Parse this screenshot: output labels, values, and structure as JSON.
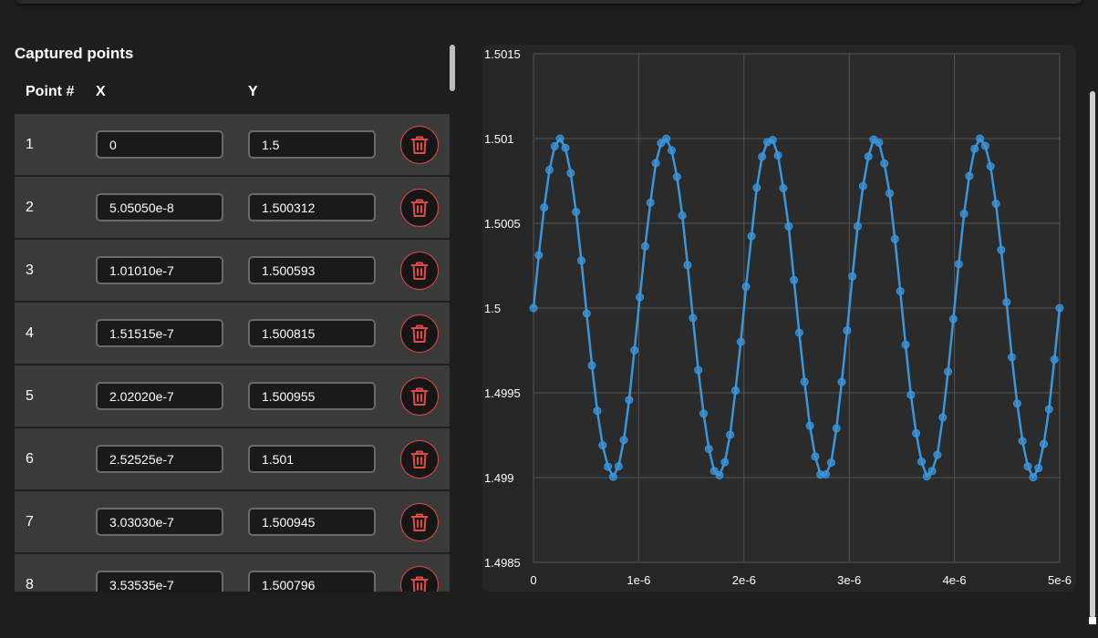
{
  "panel": {
    "title": "Captured points",
    "columns": {
      "point": "Point #",
      "x": "X",
      "y": "Y"
    }
  },
  "icons": {
    "delete": "trash-icon"
  },
  "colors": {
    "accent": "#3a96dd",
    "delete": "#e24a4a",
    "row_background": "#3a3a3a",
    "background": "#1e1e1e"
  },
  "points": [
    {
      "num": "1",
      "x": "0",
      "y": "1.5"
    },
    {
      "num": "2",
      "x": "5.05050e-8",
      "y": "1.500312"
    },
    {
      "num": "3",
      "x": "1.01010e-7",
      "y": "1.500593"
    },
    {
      "num": "4",
      "x": "1.51515e-7",
      "y": "1.500815"
    },
    {
      "num": "5",
      "x": "2.02020e-7",
      "y": "1.500955"
    },
    {
      "num": "6",
      "x": "2.52525e-7",
      "y": "1.501"
    },
    {
      "num": "7",
      "x": "3.03030e-7",
      "y": "1.500945"
    },
    {
      "num": "8",
      "x": "3.53535e-7",
      "y": "1.500796"
    }
  ],
  "chart_data": {
    "type": "line",
    "title": "",
    "xlabel": "",
    "ylabel": "",
    "xlim": [
      0,
      5e-06
    ],
    "ylim": [
      1.4985,
      1.5015
    ],
    "grid": true,
    "markers": true,
    "x_ticks": [
      0,
      1e-06,
      2e-06,
      3e-06,
      4e-06,
      5e-06
    ],
    "x_tick_labels": [
      "0",
      "1e-6",
      "2e-6",
      "3e-6",
      "4e-6",
      "5e-6"
    ],
    "y_ticks": [
      1.4985,
      1.499,
      1.4995,
      1.5,
      1.5005,
      1.501,
      1.5015
    ],
    "y_tick_labels": [
      "1.4985",
      "1.499",
      "1.4995",
      "1.5",
      "1.5005",
      "1.501",
      "1.5015"
    ],
    "series": [
      {
        "color": "#3a96dd",
        "x": [
          0,
          5.0505e-08,
          1.0101e-07,
          1.51515e-07,
          2.0202e-07,
          2.52525e-07,
          3.0303e-07,
          3.53535e-07,
          4.0404e-07,
          4.54545e-07,
          5.05051e-07,
          5.55556e-07,
          6.06061e-07,
          6.56566e-07,
          7.07071e-07,
          7.57576e-07,
          8.08081e-07,
          8.58586e-07,
          9.09091e-07,
          9.59596e-07,
          1.0101e-06,
          1.06061e-06,
          1.11111e-06,
          1.16162e-06,
          1.21212e-06,
          1.26263e-06,
          1.31313e-06,
          1.36364e-06,
          1.41414e-06,
          1.46465e-06,
          1.51515e-06,
          1.56566e-06,
          1.61616e-06,
          1.66667e-06,
          1.71717e-06,
          1.76768e-06,
          1.81818e-06,
          1.86869e-06,
          1.91919e-06,
          1.9697e-06,
          2.0202e-06,
          2.07071e-06,
          2.12121e-06,
          2.17172e-06,
          2.22222e-06,
          2.27273e-06,
          2.32323e-06,
          2.37374e-06,
          2.42424e-06,
          2.47475e-06,
          2.52525e-06,
          2.57576e-06,
          2.62626e-06,
          2.67677e-06,
          2.72727e-06,
          2.77778e-06,
          2.82828e-06,
          2.87879e-06,
          2.92929e-06,
          2.9798e-06,
          3.0303e-06,
          3.08081e-06,
          3.13131e-06,
          3.18182e-06,
          3.23232e-06,
          3.28283e-06,
          3.33333e-06,
          3.38384e-06,
          3.43434e-06,
          3.48485e-06,
          3.53535e-06,
          3.58586e-06,
          3.63636e-06,
          3.68687e-06,
          3.73737e-06,
          3.78788e-06,
          3.83838e-06,
          3.88889e-06,
          3.93939e-06,
          3.9899e-06,
          4.0404e-06,
          4.09091e-06,
          4.14141e-06,
          4.19192e-06,
          4.24242e-06,
          4.29293e-06,
          4.34343e-06,
          4.39394e-06,
          4.44444e-06,
          4.49495e-06,
          4.54545e-06,
          4.59596e-06,
          4.64646e-06,
          4.69697e-06,
          4.74747e-06,
          4.79798e-06,
          4.84848e-06,
          4.89899e-06,
          4.94949e-06,
          5e-06
        ],
        "y": [
          1.5,
          1.500312,
          1.500593,
          1.500815,
          1.500955,
          1.501,
          1.500945,
          1.500796,
          1.500567,
          1.50028,
          1.499968,
          1.499662,
          1.499394,
          1.499191,
          1.499064,
          1.499005,
          1.499066,
          1.499222,
          1.499458,
          1.499751,
          1.500064,
          1.500364,
          1.500622,
          1.500855,
          1.500973,
          1.500999,
          1.50093,
          1.500774,
          1.500546,
          1.500254,
          1.499941,
          1.499634,
          1.499378,
          1.499169,
          1.499039,
          1.499014,
          1.499091,
          1.499252,
          1.499514,
          1.499801,
          1.500127,
          1.500424,
          1.50071,
          1.500893,
          1.500979,
          1.500992,
          1.500901,
          1.500707,
          1.500482,
          1.500165,
          1.499855,
          1.499565,
          1.499306,
          1.499124,
          1.499018,
          1.499019,
          1.499088,
          1.499291,
          1.499564,
          1.499868,
          1.500187,
          1.500482,
          1.50072,
          1.500894,
          1.500994,
          1.500976,
          1.500853,
          1.500677,
          1.500407,
          1.500099,
          1.499784,
          1.499488,
          1.499262,
          1.499094,
          1.499007,
          1.499039,
          1.499134,
          1.499355,
          1.499625,
          1.499936,
          1.500259,
          1.500556,
          1.500779,
          1.50094,
          1.501,
          1.500957,
          1.500836,
          1.500616,
          1.500343,
          1.500035,
          1.49971,
          1.499437,
          1.499215,
          1.499066,
          1.499002,
          1.499056,
          1.499198,
          1.499403,
          1.499696,
          1.5
        ]
      }
    ]
  }
}
